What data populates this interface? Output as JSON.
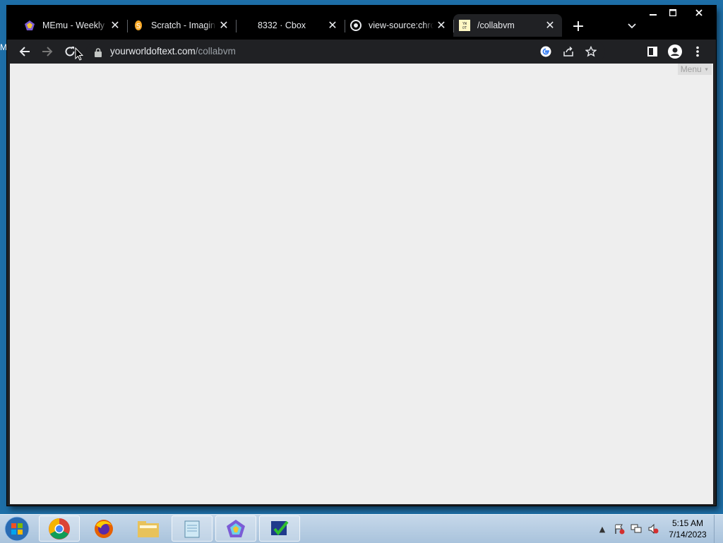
{
  "desktop": {
    "edge_label": "M"
  },
  "browser": {
    "tabs": [
      {
        "title": "MEmu - Weekly T",
        "favicon": "memu-icon",
        "active": false
      },
      {
        "title": "Scratch - Imagine",
        "favicon": "scratch-icon",
        "active": false
      },
      {
        "title": "8332 · Cbox",
        "favicon": "none",
        "active": false
      },
      {
        "title": "view-source:chro",
        "favicon": "chrome-icon",
        "active": false
      },
      {
        "title": "/collabvm",
        "favicon": "ywot-icon",
        "active": true
      }
    ],
    "new_tab_label": "+",
    "address": {
      "host": "yourworldoftext.com",
      "path": "/collabvm"
    }
  },
  "page": {
    "menu_label": "Menu"
  },
  "taskbar": {
    "apps": [
      "chrome-icon",
      "firefox-icon",
      "file-explorer-icon",
      "notepad-icon",
      "memu-icon",
      "tasks-icon"
    ],
    "clock": {
      "time": "5:15 AM",
      "date": "7/14/2023"
    }
  },
  "colors": {
    "tabstrip": "#000000",
    "toolbar": "#202124",
    "page_bg": "#eeeeee",
    "taskbar": "#b5cce3"
  }
}
